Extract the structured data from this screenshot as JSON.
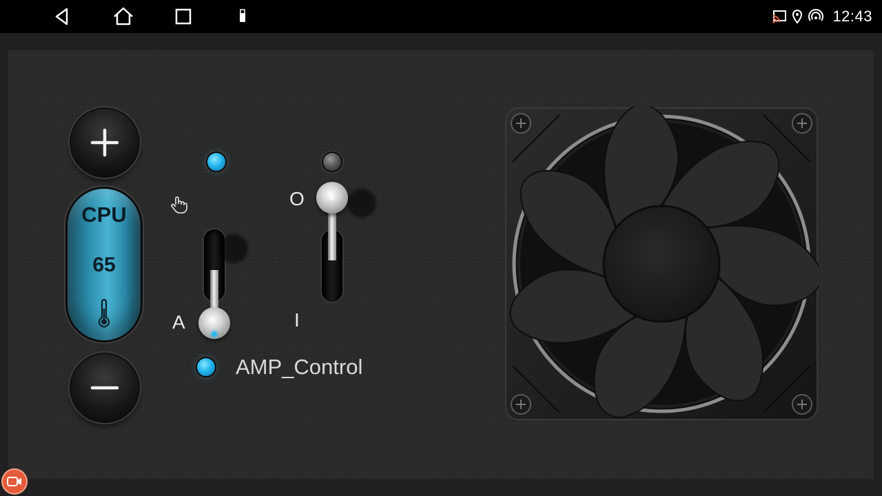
{
  "navbar": {
    "back_icon": "back-triangle-icon",
    "home_icon": "home-icon",
    "recents_icon": "recents-square-icon",
    "usb_icon": "usb-icon"
  },
  "status_bar": {
    "icons": [
      "cast-icon",
      "location-icon",
      "hotspot-icon"
    ],
    "time": "12:43"
  },
  "cpu": {
    "label": "CPU",
    "value": "65",
    "increase_icon": "plus-icon",
    "decrease_icon": "minus-icon",
    "temperature_icon": "thermometer-icon"
  },
  "switches": {
    "mode_switch": {
      "position_label": "A",
      "mode_icon": "hand-pointer-icon",
      "state": "A",
      "indicator": "on"
    },
    "power_switch": {
      "off_label": "O",
      "on_label": "I",
      "state": "O",
      "indicator": "off"
    }
  },
  "amp": {
    "label": "AMP_Control",
    "indicator": "on"
  },
  "colors": {
    "accent": "#23b5ee",
    "panel": "#2a2a2a",
    "capsule": "#3aa6c6"
  },
  "recorder_icon": "screen-recorder-icon"
}
